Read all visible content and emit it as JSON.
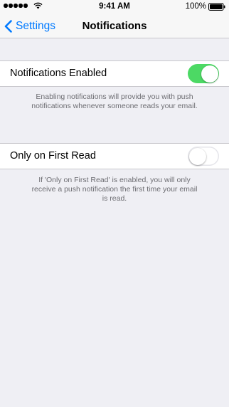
{
  "status_bar": {
    "carrier": "",
    "time": "9:41 AM",
    "battery": "100%",
    "icons": [
      "signal-icon",
      "wifi-icon",
      "battery-icon"
    ]
  },
  "nav": {
    "back_label": "Settings",
    "title": "Notifications"
  },
  "settings": [
    {
      "label": "Notifications Enabled",
      "enabled": true,
      "footer": "Enabling notifications will provide you with push notifications whenever someone reads your email."
    },
    {
      "label": "Only on First Read",
      "enabled": false,
      "footer": "If 'Only on First Read' is enabled, you will only receive a push notification the first time your email is read."
    }
  ],
  "colors": {
    "accent": "#007aff",
    "toggle_on": "#4cd964",
    "background": "#efeff4",
    "footer_text": "#6d6d72"
  }
}
